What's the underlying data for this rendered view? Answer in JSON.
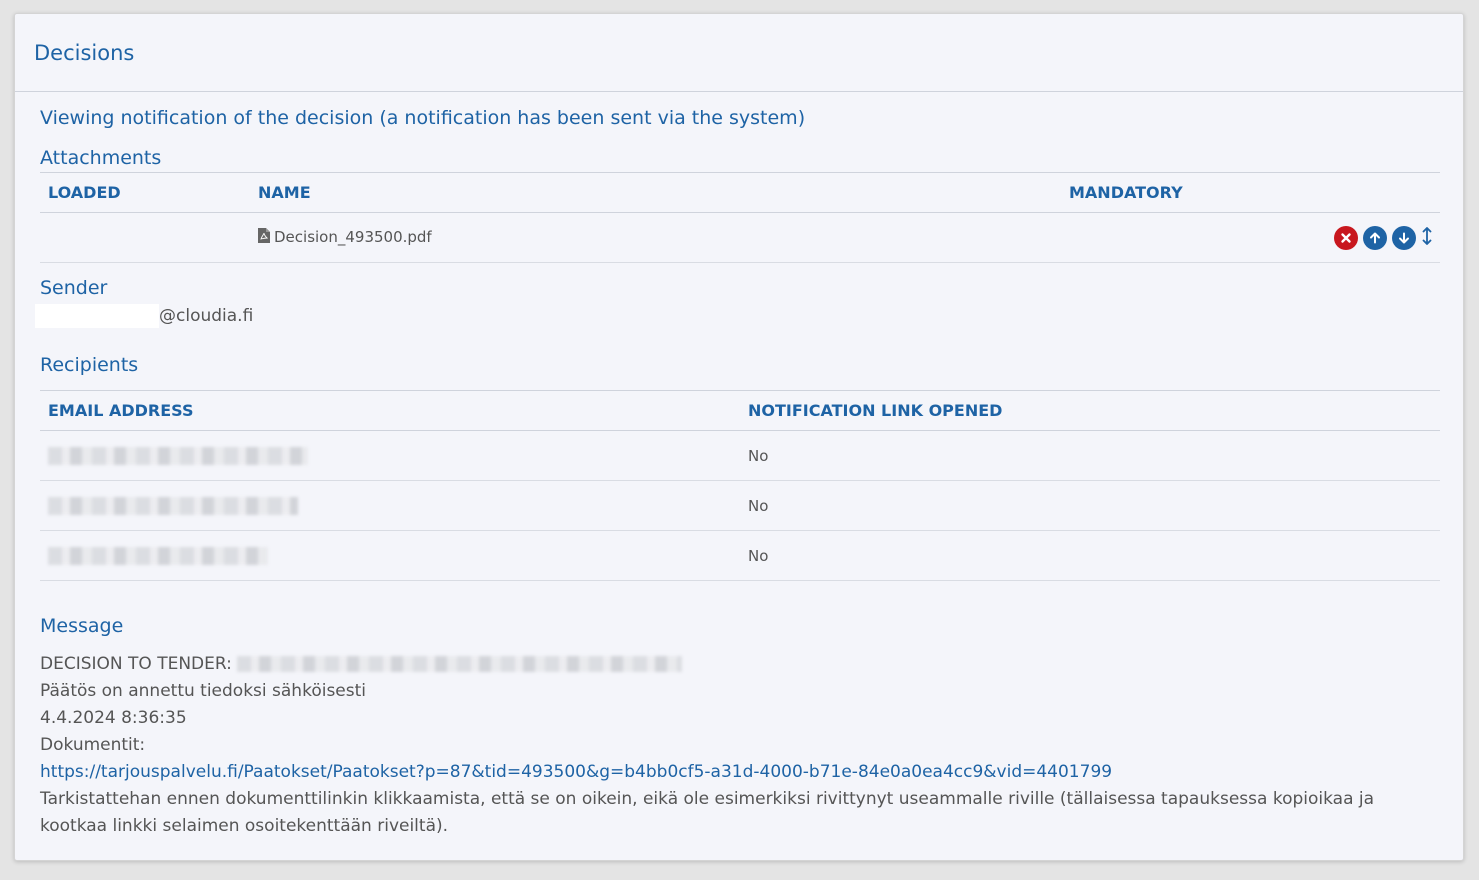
{
  "panel": {
    "title": "Decisions"
  },
  "notification": {
    "title": "Viewing notification of the decision (a notification has been sent via the system)"
  },
  "attachments": {
    "heading": "Attachments",
    "columns": {
      "loaded": "LOADED",
      "name": "NAME",
      "mandatory": "MANDATORY"
    },
    "rows": [
      {
        "loaded": "",
        "file_name": "Decision_493500.pdf",
        "mandatory": ""
      }
    ],
    "icons": {
      "file": "pdf-file-icon",
      "remove": "remove-circle-icon",
      "up": "arrow-up-circle-icon",
      "down": "arrow-down-circle-icon",
      "sort": "sort-vertical-icon"
    }
  },
  "sender": {
    "heading": "Sender",
    "email_domain": "@cloudia.fi"
  },
  "recipients": {
    "heading": "Recipients",
    "columns": {
      "email": "EMAIL ADDRESS",
      "opened": "NOTIFICATION LINK OPENED"
    },
    "rows": [
      {
        "opened": "No"
      },
      {
        "opened": "No"
      },
      {
        "opened": "No"
      }
    ]
  },
  "message": {
    "heading": "Message",
    "line_tender_label": "DECISION TO TENDER:",
    "line2": "Päätös on annettu tiedoksi sähköisesti",
    "line3": "4.4.2024 8:36:35",
    "line4": "Dokumentit:",
    "link": "https://tarjouspalvelu.fi/Paatokset/Paatokset?p=87&tid=493500&g=b4bb0cf5-a31d-4000-b71e-84e0a0ea4cc9&vid=4401799",
    "note": "Tarkistattehan ennen dokumenttilinkin klikkaamista, että se on oikein, eikä ole esimerkiksi rivittynyt useammalle riville (tällaisessa tapauksessa kopioikaa ja kootkaa linkki selaimen osoitekenttään riveiltä)."
  },
  "colors": {
    "accent": "#1e63a5",
    "danger": "#c8171e"
  }
}
